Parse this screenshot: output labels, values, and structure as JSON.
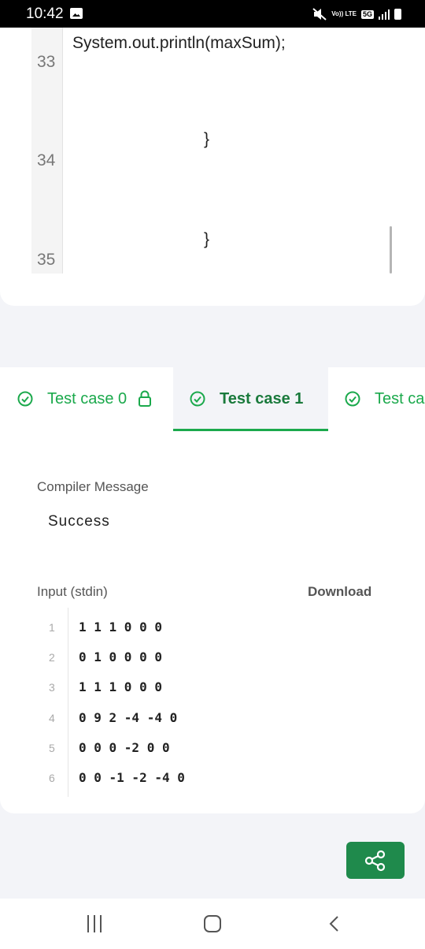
{
  "status_bar": {
    "time": "10:42",
    "network": "5G",
    "lte": "Vo)) LTE"
  },
  "editor": {
    "lines": [
      {
        "number": "33",
        "code": "System.out.println(maxSum);"
      },
      {
        "number": "34",
        "code": "}"
      },
      {
        "number": "35",
        "code": "}"
      }
    ]
  },
  "tabs": [
    {
      "label": "Test case 0",
      "locked": true,
      "active": false
    },
    {
      "label": "Test case 1",
      "locked": false,
      "active": true
    },
    {
      "label": "Test ca",
      "locked": false,
      "active": false
    }
  ],
  "result": {
    "compiler_message_label": "Compiler Message",
    "compiler_message_value": "Success",
    "input_label": "Input (stdin)",
    "download_label": "Download",
    "input_lines": [
      {
        "n": "1",
        "text": "1 1 1 0 0 0"
      },
      {
        "n": "2",
        "text": "0 1 0 0 0 0"
      },
      {
        "n": "3",
        "text": "1 1 1 0 0 0"
      },
      {
        "n": "4",
        "text": "0 9 2 -4 -4 0"
      },
      {
        "n": "5",
        "text": "0 0 0 -2 0 0"
      },
      {
        "n": "6",
        "text": "0 0 -1 -2 -4 0"
      }
    ]
  },
  "colors": {
    "accent_green": "#1ba94c",
    "share_button": "#1f8a4c"
  }
}
